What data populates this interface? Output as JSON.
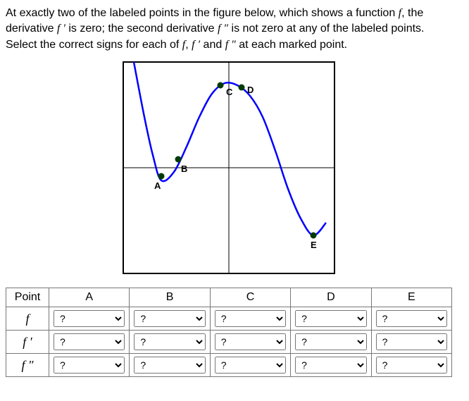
{
  "prompt": {
    "part1": "At exactly two of the labeled points in the figure below, which shows a function ",
    "f": "f",
    "part2": ", the derivative ",
    "fp": "f ′",
    "part3": " is zero; the second derivative ",
    "fpp": "f ″",
    "part4": " is not zero at any of the labeled points. Select the correct signs for each of ",
    "f2": "f",
    "comma": ", ",
    "fp2": "f ′",
    "part5": " and ",
    "fpp2": "f ″",
    "part6": " at each marked point."
  },
  "table": {
    "head_point": "Point",
    "cols": [
      "A",
      "B",
      "C",
      "D",
      "E"
    ],
    "rows": [
      "f",
      "f ′",
      "f ″"
    ],
    "placeholder": "?"
  },
  "chart_data": {
    "type": "line",
    "title": "",
    "xlabel": "",
    "ylabel": "",
    "xlim": [
      -5,
      5
    ],
    "ylim": [
      -5,
      5
    ],
    "series": [
      {
        "name": "f",
        "x": [
          -4.5,
          -4.0,
          -3.6,
          -3.2,
          -2.6,
          -2.0,
          -1.4,
          -0.8,
          -0.2,
          0.4,
          1.0,
          1.6,
          2.2,
          2.8,
          3.4,
          4.0,
          4.6
        ],
        "y": [
          5.0,
          2.4,
          0.6,
          -0.6,
          -0.2,
          1.0,
          2.4,
          3.5,
          4.0,
          3.9,
          3.4,
          2.4,
          0.8,
          -1.0,
          -2.4,
          -3.2,
          -2.6
        ]
      }
    ],
    "labeled_points": [
      {
        "name": "A",
        "x": -3.2,
        "y": -0.4,
        "label_dx": -10,
        "label_dy": 18
      },
      {
        "name": "B",
        "x": -2.4,
        "y": 0.4,
        "label_dx": 4,
        "label_dy": 18
      },
      {
        "name": "C",
        "x": -0.4,
        "y": 3.9,
        "label_dx": 8,
        "label_dy": 14
      },
      {
        "name": "D",
        "x": 0.6,
        "y": 3.8,
        "label_dx": 8,
        "label_dy": 8
      },
      {
        "name": "E",
        "x": 4.0,
        "y": -3.2,
        "label_dx": -4,
        "label_dy": 18
      }
    ]
  }
}
